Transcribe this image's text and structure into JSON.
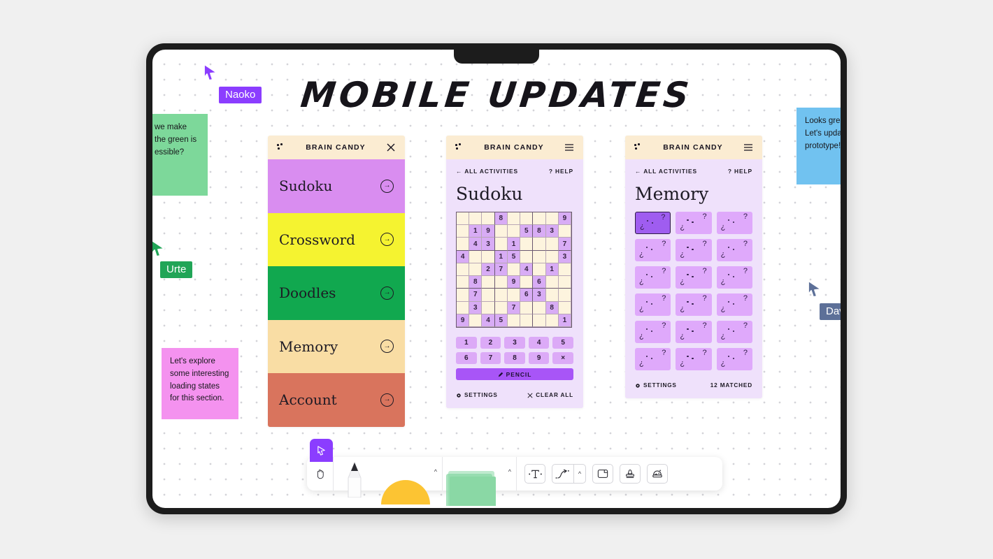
{
  "board": {
    "title": "MOBILE UPDATES"
  },
  "notes": [
    {
      "id": "green",
      "text": "we make the green is essible?",
      "color": "#7dd89a"
    },
    {
      "id": "pink",
      "text": "Let's explore some interesting loading states for this section.",
      "color": "#f492ef"
    },
    {
      "id": "blue",
      "text": "Looks great! Let's update th prototype!!",
      "color": "#71c2f0"
    }
  ],
  "collaborators": [
    {
      "name": "Naoko",
      "color": "#8b3dff"
    },
    {
      "name": "Urte",
      "color": "#21a557"
    },
    {
      "name": "Dav",
      "color": "#5d7098"
    }
  ],
  "brand": "BRAIN CANDY",
  "phone_list": {
    "close_icon": "close-icon",
    "items": [
      {
        "label": "Sudoku",
        "color": "#d98df0"
      },
      {
        "label": "Crossword",
        "color": "#f5f330"
      },
      {
        "label": "Doodles",
        "color": "#11a84f"
      },
      {
        "label": "Memory",
        "color": "#f9dda4"
      },
      {
        "label": "Account",
        "color": "#d9745d"
      }
    ]
  },
  "phone_sudoku": {
    "menu_icon": "hamburger-icon",
    "back_label": "← ALL ACTIVITIES",
    "help_label": "? HELP",
    "title": "Sudoku",
    "grid": [
      [
        "",
        "",
        "",
        "8",
        "",
        "",
        "",
        "",
        "9"
      ],
      [
        "",
        "1",
        "9",
        "",
        "",
        "5",
        "8",
        "3",
        ""
      ],
      [
        "",
        "4",
        "3",
        "",
        "1",
        "",
        "",
        "",
        "7"
      ],
      [
        "4",
        "",
        "",
        "1",
        "5",
        "",
        "",
        "",
        "3"
      ],
      [
        "",
        "",
        "2",
        "7",
        "",
        "4",
        "",
        "1",
        ""
      ],
      [
        "",
        "8",
        "",
        "",
        "9",
        "",
        "6",
        "",
        ""
      ],
      [
        "",
        "7",
        "",
        "",
        "",
        "6",
        "3",
        "",
        ""
      ],
      [
        "",
        "3",
        "",
        "",
        "7",
        "",
        "",
        "8",
        ""
      ],
      [
        "9",
        "",
        "4",
        "5",
        "",
        "",
        "",
        "",
        "1"
      ]
    ],
    "numpad": [
      "1",
      "2",
      "3",
      "4",
      "5",
      "6",
      "7",
      "8",
      "9",
      "×"
    ],
    "pencil_label": "PENCIL",
    "settings_label": "SETTINGS",
    "clear_label": "CLEAR ALL"
  },
  "phone_memory": {
    "menu_icon": "hamburger-icon",
    "back_label": "← ALL ACTIVITIES",
    "help_label": "? HELP",
    "title": "Memory",
    "card_glyph_left": "¿",
    "card_glyph_right": "?",
    "card_count": 18,
    "selected_index": 0,
    "settings_label": "SETTINGS",
    "matched_label": "12 MATCHED"
  },
  "toolbar": {
    "select_icon": "cursor-select-icon",
    "hand_icon": "hand-icon",
    "pen_icon": "pen-icon",
    "marker_icon": "marker-icon",
    "note_icon": "sticky-note-icon",
    "text_icon": "text-tool-icon",
    "connector_icon": "connector-arrow-icon",
    "frame_icon": "frame-icon",
    "stamp_icon": "stamp-icon",
    "sticker_icon": "sticker-icon",
    "marker_color": "#fcc433",
    "note_color": "#8ad8a5"
  }
}
